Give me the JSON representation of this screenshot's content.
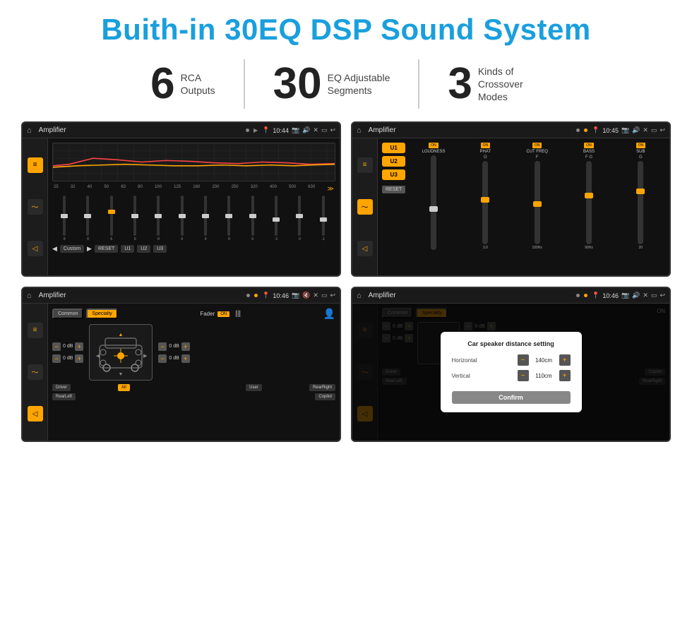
{
  "title": "Buith-in 30EQ DSP Sound System",
  "stats": [
    {
      "number": "6",
      "label": "RCA\nOutputs"
    },
    {
      "number": "30",
      "label": "EQ Adjustable\nSegments"
    },
    {
      "number": "3",
      "label": "Kinds of\nCrossover Modes"
    }
  ],
  "screens": [
    {
      "id": "eq-screen",
      "title": "Amplifier",
      "time": "10:44",
      "type": "eq",
      "freq_labels": [
        "25",
        "32",
        "40",
        "50",
        "63",
        "80",
        "100",
        "125",
        "160",
        "200",
        "250",
        "320",
        "400",
        "500",
        "630"
      ],
      "eq_values": [
        "0",
        "0",
        "0",
        "5",
        "0",
        "0",
        "0",
        "0",
        "0",
        "0",
        "0",
        "-1",
        "0",
        "-1"
      ],
      "preset": "Custom",
      "buttons": [
        "RESET",
        "U1",
        "U2",
        "U3"
      ]
    },
    {
      "id": "crossover-screen",
      "title": "Amplifier",
      "time": "10:45",
      "type": "crossover",
      "tabs": [
        "U1",
        "U2",
        "U3"
      ],
      "controls": [
        "LOUDNESS",
        "PHAT",
        "CUT FREQ",
        "BASS",
        "SUB"
      ]
    },
    {
      "id": "fader-screen",
      "title": "Amplifier",
      "time": "10:46",
      "type": "fader",
      "top_tabs": [
        "Common",
        "Specialty"
      ],
      "fader_label": "Fader",
      "fader_on": "ON",
      "db_values": [
        "0 dB",
        "0 dB",
        "0 dB",
        "0 dB"
      ],
      "bottom_buttons": [
        "Driver",
        "",
        "",
        "User",
        "RearRight"
      ],
      "all_btn": "All",
      "copilot_btn": "Copilot",
      "driver_btn": "Driver",
      "rearleft_btn": "RearLeft",
      "rearright_btn": "RearRight",
      "user_btn": "User"
    },
    {
      "id": "dialog-screen",
      "title": "Amplifier",
      "time": "10:46",
      "type": "dialog",
      "top_tabs": [
        "Common",
        "Specialty"
      ],
      "dialog": {
        "title": "Car speaker distance setting",
        "horizontal_label": "Horizontal",
        "horizontal_value": "140cm",
        "vertical_label": "Vertical",
        "vertical_value": "110cm",
        "confirm_btn": "Confirm"
      },
      "db_right": [
        "0 dB",
        "0 dB"
      ],
      "driver_btn": "Driver",
      "copilot_btn": "Copilot",
      "rearleft_btn": "RearLeft.",
      "rearright_btn": "RearRight"
    }
  ],
  "colors": {
    "accent": "#ffa500",
    "title_blue": "#1a9fdd",
    "bg_dark": "#111111"
  }
}
